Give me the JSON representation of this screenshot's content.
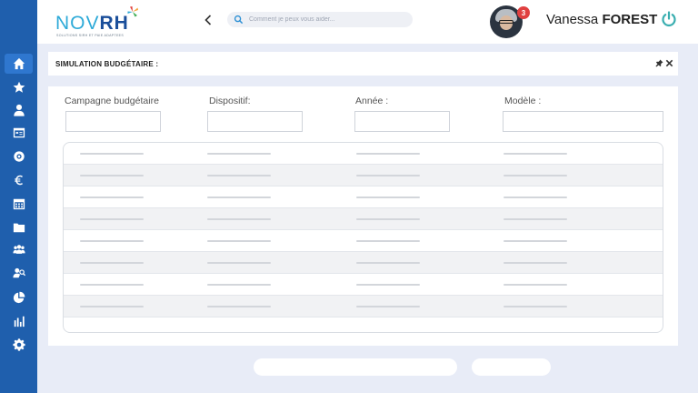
{
  "header": {
    "logo": {
      "brand_primary": "NOV",
      "brand_secondary": "RH",
      "tagline": "SOLUTIONS SIRH ET PAIE ADAPTEES"
    },
    "search": {
      "placeholder": "Comment je peux vous aider..."
    },
    "notifications": {
      "count": "3"
    },
    "user": {
      "first_name": "Vanessa",
      "last_name": "FOREST"
    }
  },
  "sidebar": {
    "items": [
      {
        "name": "home-icon",
        "active": true
      },
      {
        "name": "star-icon"
      },
      {
        "name": "user-icon"
      },
      {
        "name": "calendar-card-icon"
      },
      {
        "name": "gear-badge-icon"
      },
      {
        "name": "euro-icon"
      },
      {
        "name": "calendar-grid-icon"
      },
      {
        "name": "folder-icon"
      },
      {
        "name": "group-icon"
      },
      {
        "name": "user-search-icon"
      },
      {
        "name": "pie-chart-icon"
      },
      {
        "name": "bar-chart-icon"
      },
      {
        "name": "settings-icon"
      }
    ]
  },
  "panel": {
    "title": "SIMULATION BUDGÉTAIRE :",
    "fields": [
      {
        "label": "Campagne budgétaire",
        "value": ""
      },
      {
        "label": "Dispositif:",
        "value": ""
      },
      {
        "label": "Année :",
        "value": ""
      },
      {
        "label": "Modèle :",
        "value": ""
      }
    ],
    "row_count": 8
  },
  "colors": {
    "sidebar": "#1f5fad",
    "accent": "#2eaad8",
    "brand_dark": "#1a4e9a",
    "badge": "#e04040",
    "power": "#3aaeb0",
    "background": "#e8ecf7"
  }
}
